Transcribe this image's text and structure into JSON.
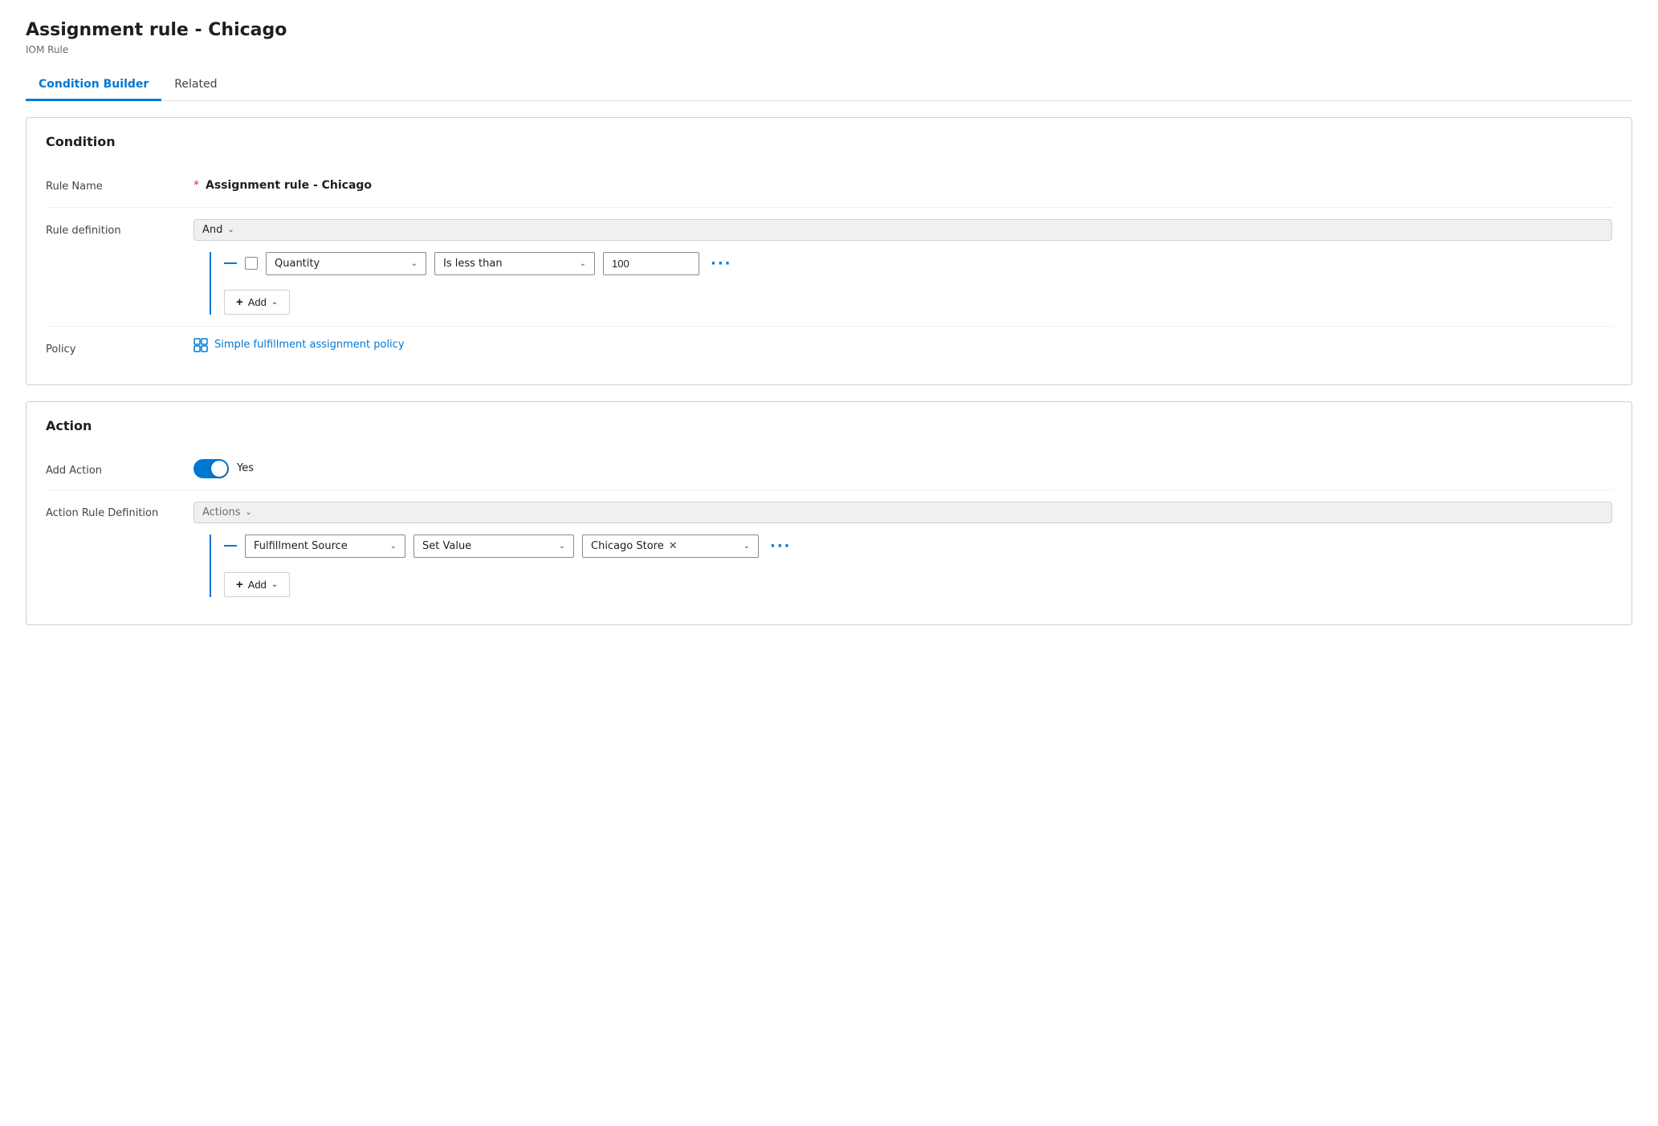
{
  "page": {
    "title": "Assignment rule - Chicago",
    "subtitle": "IOM Rule"
  },
  "tabs": [
    {
      "id": "condition-builder",
      "label": "Condition Builder",
      "active": true
    },
    {
      "id": "related",
      "label": "Related",
      "active": false
    }
  ],
  "condition_section": {
    "title": "Condition",
    "fields": {
      "rule_name": {
        "label": "Rule Name",
        "required": true,
        "value": "Assignment rule - Chicago"
      },
      "rule_definition": {
        "label": "Rule definition",
        "and_label": "And",
        "condition_row": {
          "field_dropdown": "Quantity",
          "operator_dropdown": "Is less than",
          "value": "100"
        },
        "add_button_label": "Add"
      },
      "policy": {
        "label": "Policy",
        "link_text": "Simple fulfillment assignment policy"
      }
    }
  },
  "action_section": {
    "title": "Action",
    "fields": {
      "add_action": {
        "label": "Add Action",
        "toggle_on": true,
        "toggle_value": "Yes"
      },
      "action_rule_definition": {
        "label": "Action Rule Definition",
        "actions_label": "Actions",
        "action_row": {
          "field_dropdown": "Fulfillment Source",
          "operator_dropdown": "Set Value",
          "value_chip": "Chicago Store"
        },
        "add_button_label": "Add"
      }
    }
  },
  "icons": {
    "chevron_down": "∨",
    "plus": "+",
    "ellipsis": "···",
    "close": "×",
    "policy_icon": "⊞"
  }
}
